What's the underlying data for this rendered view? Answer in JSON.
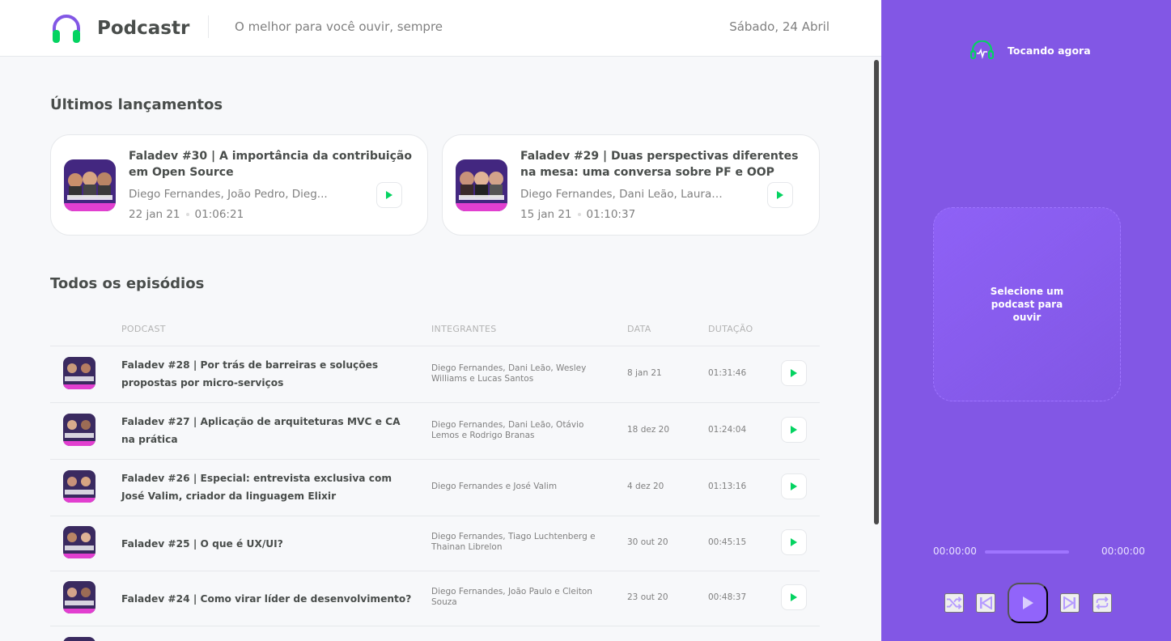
{
  "app": {
    "name": "Podcastr",
    "tagline": "O melhor para você ouvir, sempre",
    "date": "Sábado, 24 Abril"
  },
  "colors": {
    "accent": "#8257e5",
    "play_green": "#04d361",
    "text": "#494d4b",
    "muted": "#808080"
  },
  "latest": {
    "title": "Últimos lançamentos",
    "episodes": [
      {
        "title": "Faladev #30 | A importância da contribuição em Open Source",
        "members": "Diego Fernandes, João Pedro, Dieg...",
        "date": "22 jan 21",
        "duration": "01:06:21"
      },
      {
        "title": "Faladev #29 | Duas perspectivas diferentes na mesa: uma conversa sobre PF e OOP",
        "members": "Diego Fernandes, Dani Leão, Laura ...",
        "date": "15 jan 21",
        "duration": "01:10:37"
      }
    ]
  },
  "all": {
    "title": "Todos os episódios",
    "columns": {
      "podcast": "PODCAST",
      "members": "INTEGRANTES",
      "date": "DATA",
      "duration": "DUTAÇÃO"
    },
    "rows": [
      {
        "title": "Faladev #28 | Por trás de barreiras e soluções propostas por micro-serviços",
        "members": "Diego Fernandes, Dani Leão, Wesley Williams e Lucas Santos",
        "date": "8 jan 21",
        "duration": "01:31:46"
      },
      {
        "title": "Faladev #27 | Aplicação de arquiteturas MVC e CA na prática",
        "members": "Diego Fernandes, Dani Leão, Otávio Lemos e Rodrigo Branas",
        "date": "18 dez 20",
        "duration": "01:24:04"
      },
      {
        "title": "Faladev #26 | Especial: entrevista exclusiva com José Valim, criador da linguagem Elixir",
        "members": "Diego Fernandes e José Valim",
        "date": "4 dez 20",
        "duration": "01:13:16"
      },
      {
        "title": "Faladev #25 | O que é UX/UI?",
        "members": "Diego Fernandes, Tiago Luchtenberg e Thainan Librelon",
        "date": "30 out 20",
        "duration": "00:45:15"
      },
      {
        "title": "Faladev #24 | Como virar líder de desenvolvimento?",
        "members": "Diego Fernandes, João Paulo e Cleiton Souza",
        "date": "23 out 20",
        "duration": "00:48:37"
      }
    ]
  },
  "player": {
    "label": "Tocando agora",
    "empty": "Selecione um podcast para ouvir",
    "current_time": "00:00:00",
    "total_time": "00:00:00"
  }
}
